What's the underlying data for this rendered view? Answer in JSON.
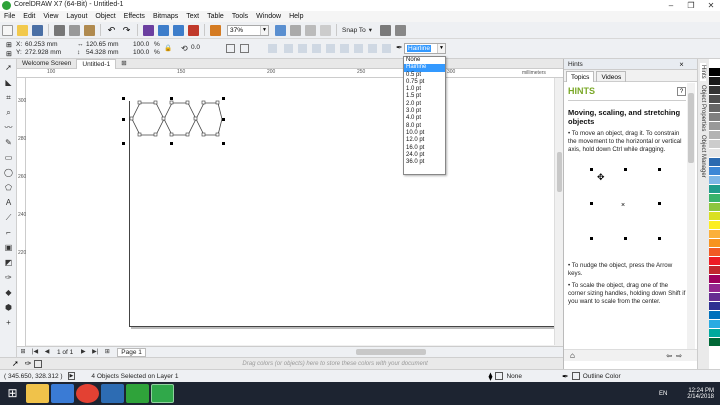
{
  "window": {
    "title": "CorelDRAW X7 (64-Bit) - Untitled-1",
    "controls": [
      "–",
      "❐",
      "✕"
    ]
  },
  "menu": [
    "File",
    "Edit",
    "View",
    "Layout",
    "Object",
    "Effects",
    "Bitmaps",
    "Text",
    "Table",
    "Tools",
    "Window",
    "Help"
  ],
  "toolbar": {
    "zoom": "37%",
    "snap_to": "Snap To",
    "icons": [
      "new-icon",
      "open-icon",
      "save-icon",
      "cut-icon",
      "copy-icon",
      "paste-icon",
      "undo-icon",
      "redo-icon",
      "search-content-icon",
      "import-icon",
      "export-icon",
      "publish-pdf-icon",
      "app-launcher-icon"
    ]
  },
  "propbar": {
    "x_label": "X:",
    "x_value": "60.253 mm",
    "y_label": "Y:",
    "y_value": "272.928 mm",
    "width_value": "120.65 mm",
    "height_value": "54.328 mm",
    "scale_x": "100.0",
    "scale_y": "100.0",
    "percent": "%",
    "rotation": "0.0",
    "outline_width": "Hairline"
  },
  "document_tabs": [
    "Welcome Screen",
    "Untitled-1"
  ],
  "ruler": {
    "unit": "millimeters",
    "h_ticks": [
      "100",
      "150",
      "200",
      "250",
      "300",
      "350"
    ],
    "v_ticks": [
      "300",
      "280",
      "260",
      "240",
      "220"
    ]
  },
  "dropdown": {
    "items": [
      "None",
      "Hairline",
      "0.5 pt",
      "0.75 pt",
      "1.0 pt",
      "1.5 pt",
      "2.0 pt",
      "3.0 pt",
      "4.0 pt",
      "8.0 pt",
      "10.0 pt",
      "12.0 pt",
      "16.0 pt",
      "24.0 pt",
      "36.0 pt"
    ],
    "selected_index": 1
  },
  "pagenav": {
    "count": "1 of 1",
    "page_tab": "Page 1"
  },
  "palette_hint": "Drag colors (or objects) here to store these colors with your document",
  "status": {
    "coords": "( 345.650, 328.312 )",
    "selection": "4 Objects Selected on Layer 1",
    "fill": "None",
    "outline": "Outline Color"
  },
  "docker": {
    "header": "Hints",
    "tabs": [
      "Topics",
      "Videos"
    ],
    "title": "HINTS",
    "heading": "Moving, scaling, and stretching objects",
    "paragraphs": [
      "• To move an object, drag it. To constrain the movement to the horizontal or vertical axis, hold down Ctrl while dragging.",
      "• To nudge the object, press the Arrow keys.",
      "• To scale the object, drag one of the corner sizing handles, holding down Shift if you want to scale from the center."
    ]
  },
  "sidetabs": [
    "Hints",
    "Object Properties",
    "Object Manager"
  ],
  "taskbar": {
    "time": "12:24 PM",
    "date": "2/14/2018",
    "lang": "EN"
  },
  "colors": {
    "accent": "#3399ff",
    "hints_green": "#7aa827",
    "taskbar": "#1d2431",
    "swatches": [
      "#ffffff",
      "#000000",
      "#1a1a1a",
      "#333333",
      "#4d4d4d",
      "#666666",
      "#808080",
      "#999999",
      "#b3b3b3",
      "#cccccc",
      "#e6e6e6",
      "#2b6ab0",
      "#3d87d6",
      "#7fb7e8",
      "#1f9c8c",
      "#38b36b",
      "#8cc63f",
      "#d9e021",
      "#fcee21",
      "#fbb03b",
      "#f7931e",
      "#f15a24",
      "#ed1c24",
      "#c1272d",
      "#9e005d",
      "#93278f",
      "#662d91",
      "#2e3192",
      "#0071bc",
      "#29abe2",
      "#00a99d",
      "#006837"
    ]
  }
}
